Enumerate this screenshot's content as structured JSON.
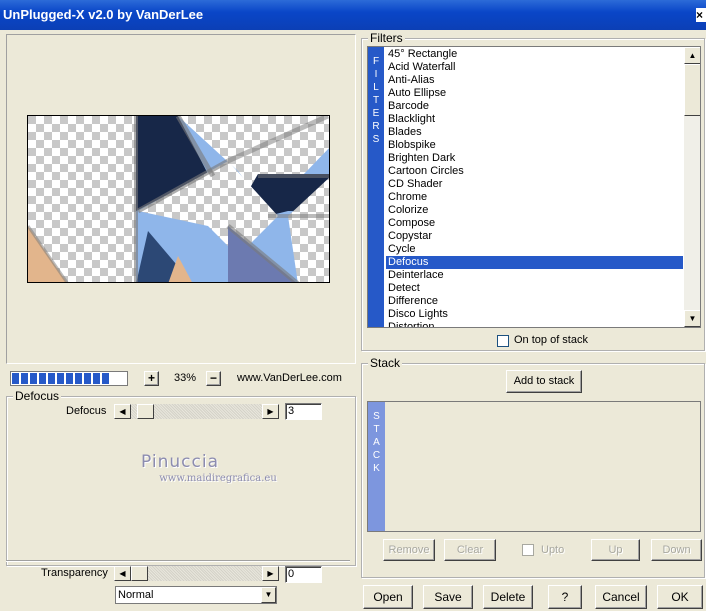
{
  "window": {
    "title": "UnPlugged-X v2.0 by VanDerLee",
    "close": "×"
  },
  "preview": {
    "zoom": "33%",
    "zoom_in": "+",
    "zoom_out": "−",
    "website": "www.VanDerLee.com",
    "progress_segments": 11
  },
  "filters": {
    "group_title": "Filters",
    "vertical_tag": [
      "F",
      "I",
      "L",
      "T",
      "E",
      "R",
      "S"
    ],
    "items": [
      "45° Rectangle",
      "Acid Waterfall",
      "Anti-Alias",
      "Auto Ellipse",
      "Barcode",
      "Blacklight",
      "Blades",
      "Blobspike",
      "Brighten Dark",
      "Cartoon Circles",
      "CD Shader",
      "Chrome",
      "Colorize",
      "Compose",
      "Copystar",
      "Cycle",
      "Defocus",
      "Deinterlace",
      "Detect",
      "Difference",
      "Disco Lights",
      "Distortion"
    ],
    "selected": "Defocus",
    "on_top_label": "On top of stack"
  },
  "defocus": {
    "group_title": "Defocus",
    "param_label": "Defocus",
    "param_value": "3"
  },
  "watermark": {
    "name": "Pinuccia",
    "site": "www.maidiregrafica.eu"
  },
  "transparency": {
    "label": "Transparency",
    "value": "0",
    "mode": "Normal"
  },
  "stack": {
    "group_title": "Stack",
    "add_button": "Add to stack",
    "vertical_tag": [
      "S",
      "T",
      "A",
      "C",
      "K"
    ],
    "remove": "Remove",
    "clear": "Clear",
    "upto": "Upto",
    "up": "Up",
    "down": "Down"
  },
  "bottom": {
    "open": "Open",
    "save": "Save",
    "delete": "Delete",
    "help": "?",
    "cancel": "Cancel",
    "ok": "OK"
  },
  "colors": {
    "accent": "#2659c8",
    "title_bar": "#0a46c8"
  },
  "icons": {
    "arrow_left": "◀",
    "arrow_right": "▶",
    "arrow_up": "▲",
    "arrow_down": "▼",
    "dropdown": "▼"
  }
}
